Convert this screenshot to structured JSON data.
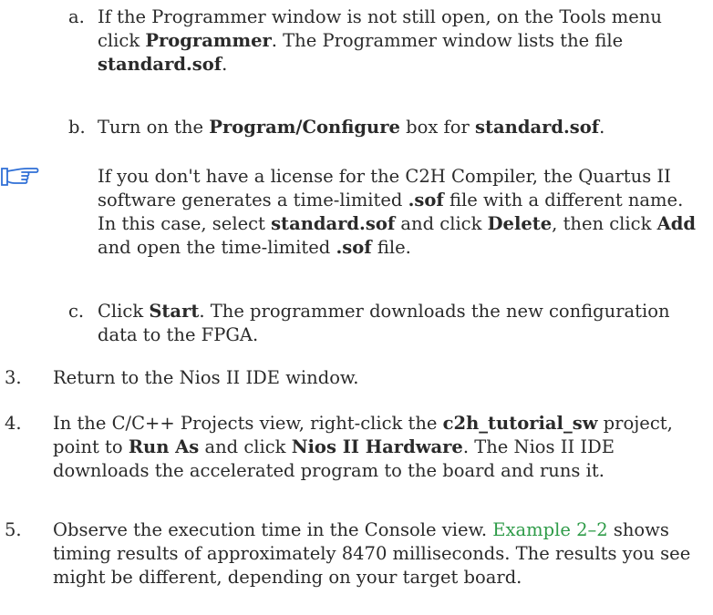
{
  "steps": {
    "a": {
      "label": "a.",
      "t1": "If the Programmer window is not still open, on the Tools menu click ",
      "b1": "Programmer",
      "t2": ". The Programmer window lists the file ",
      "b2": "standard.sof",
      "t3": "."
    },
    "b": {
      "label": "b.",
      "t1": "Turn on the ",
      "b1": "Program/Configure",
      "t2": " box for ",
      "b2": "standard.sof",
      "t3": "."
    },
    "note": {
      "icon": "pointing-hand-icon",
      "t1": "If you don't have a license for the C2H Compiler, the Quartus II software generates a time-limited ",
      "b1": ".sof",
      "t2": " file with a different name. In this case, select ",
      "b2": "standard.sof",
      "t3": " and click ",
      "b3": "Delete",
      "t4": ", then click ",
      "b4": "Add",
      "t5": " and open the time-limited ",
      "b5": ".sof",
      "t6": " file."
    },
    "c": {
      "label": "c.",
      "t1": "Click ",
      "b1": "Start",
      "t2": ". The programmer downloads the new configuration data to the FPGA."
    },
    "s3": {
      "label": "3.",
      "t1": "Return to the Nios II IDE window."
    },
    "s4": {
      "label": "4.",
      "t1": "In the C/C++ Projects view, right-click the ",
      "b1": "c2h_tutorial_sw",
      "t2": " project, point to ",
      "b2": "Run As",
      "t3": " and click ",
      "b3": "Nios II Hardware",
      "t4": ". The Nios II IDE downloads the accelerated program to the board and runs it."
    },
    "s5": {
      "label": "5.",
      "t1": "Observe the execution time in the Console view. ",
      "link": "Example 2–2",
      "t2": " shows timing results of approximately 8470 milliseconds. The results you see might be different, depending on your target board."
    }
  },
  "colors": {
    "text": "#2a2a2a",
    "link": "#2e9b48",
    "icon": "#2f6fd6"
  }
}
